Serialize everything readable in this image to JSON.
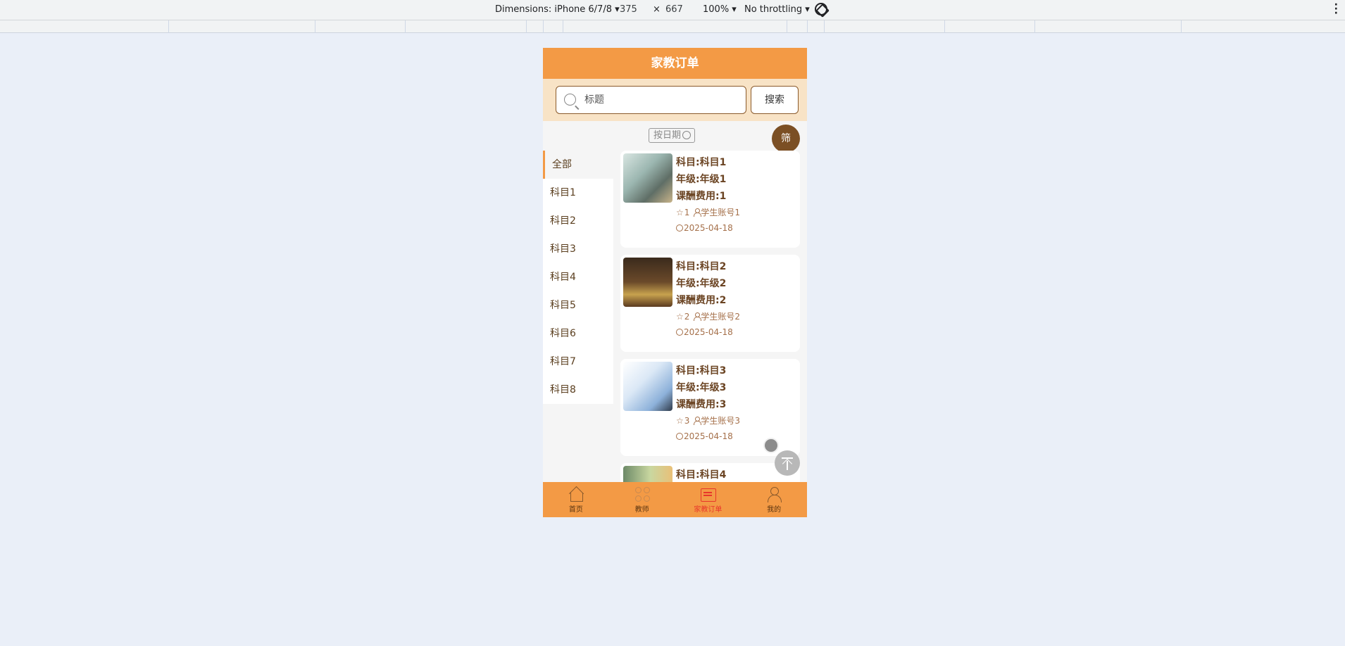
{
  "devtools": {
    "dimensions_label": "Dimensions: iPhone 6/7/8",
    "width": "375",
    "times": "×",
    "height": "667",
    "zoom": "100%",
    "throttling": "No throttling"
  },
  "header": {
    "title": "家教订单"
  },
  "search": {
    "placeholder": "标题",
    "button": "搜索"
  },
  "sort": {
    "label": "按日期"
  },
  "filter": {
    "label": "筛"
  },
  "categories": [
    {
      "label": "全部",
      "active": true
    },
    {
      "label": "科目1"
    },
    {
      "label": "科目2"
    },
    {
      "label": "科目3"
    },
    {
      "label": "科目4"
    },
    {
      "label": "科目5"
    },
    {
      "label": "科目6"
    },
    {
      "label": "科目7"
    },
    {
      "label": "科目8"
    }
  ],
  "orders": [
    {
      "subject": "科目:科目1",
      "grade": "年级:年级1",
      "fee": "课酬费用:1",
      "stars": "1",
      "student": "学生账号1",
      "date": "2025-04-18"
    },
    {
      "subject": "科目:科目2",
      "grade": "年级:年级2",
      "fee": "课酬费用:2",
      "stars": "2",
      "student": "学生账号2",
      "date": "2025-04-18"
    },
    {
      "subject": "科目:科目3",
      "grade": "年级:年级3",
      "fee": "课酬费用:3",
      "stars": "3",
      "student": "学生账号3",
      "date": "2025-04-18"
    },
    {
      "subject": "科目:科目4"
    }
  ],
  "tabbar": [
    {
      "label": "首页",
      "icon": "home-icon"
    },
    {
      "label": "教师",
      "icon": "grid-icon"
    },
    {
      "label": "家教订单",
      "icon": "calendar-icon",
      "active": true
    },
    {
      "label": "我的",
      "icon": "user-icon"
    }
  ],
  "colors": {
    "accent": "#f39a45",
    "brown": "#7b4f24",
    "active_tab": "#e8362b"
  }
}
